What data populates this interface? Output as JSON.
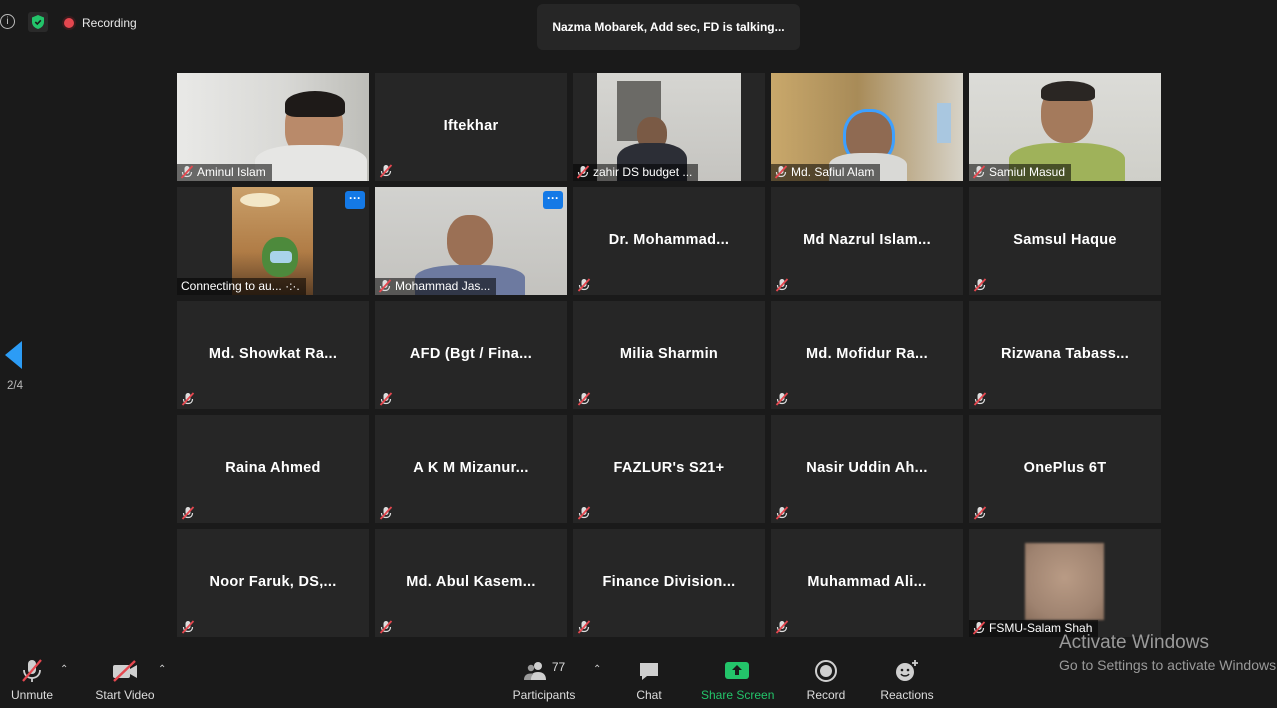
{
  "topbar": {
    "recording_label": "Recording",
    "speaking_banner": "Nazma Mobarek, Add sec, FD is talking...",
    "colors": {
      "recording": "#e5474f",
      "shield": "#23c46a"
    }
  },
  "pager": {
    "label": "2/4",
    "arrow_color": "#2c9cf5"
  },
  "tiles": [
    {
      "name": "Aminul Islam",
      "video": true,
      "muted": true
    },
    {
      "name": "Iftekhar",
      "video": false,
      "muted": true
    },
    {
      "name": "zahir DS budget ...",
      "video": true,
      "muted": true
    },
    {
      "name": "Md. Safiul Alam",
      "video": true,
      "muted": true
    },
    {
      "name": "Samiul Masud",
      "video": true,
      "muted": true
    },
    {
      "name": "Connecting to au... ·:·.",
      "video": true,
      "muted": false,
      "more": "···"
    },
    {
      "name": "Mohammad Jas...",
      "video": true,
      "muted": true,
      "more": "···"
    },
    {
      "name": "Dr.  Mohammad...",
      "video": false,
      "muted": true
    },
    {
      "name": "Md Nazrul Islam...",
      "video": false,
      "muted": true
    },
    {
      "name": "Samsul Haque",
      "video": false,
      "muted": true
    },
    {
      "name": "Md.  Showkat  Ra...",
      "video": false,
      "muted": true
    },
    {
      "name": "AFD (Bgt / Fina...",
      "video": false,
      "muted": true
    },
    {
      "name": "Milia Sharmin",
      "video": false,
      "muted": true
    },
    {
      "name": "Md.  Mofidur  Ra...",
      "video": false,
      "muted": true
    },
    {
      "name": "Rizwana  Tabass...",
      "video": false,
      "muted": true
    },
    {
      "name": "Raina Ahmed",
      "video": false,
      "muted": true
    },
    {
      "name": "A  K  M  Mizanur...",
      "video": false,
      "muted": true
    },
    {
      "name": "FAZLUR's S21+",
      "video": false,
      "muted": true
    },
    {
      "name": "Nasir  Uddin  Ah...",
      "video": false,
      "muted": true
    },
    {
      "name": "OnePlus 6T",
      "video": false,
      "muted": true
    },
    {
      "name": "Noor Faruk,  DS,...",
      "video": false,
      "muted": true
    },
    {
      "name": "Md.  Abul  Kasem...",
      "video": false,
      "muted": true
    },
    {
      "name": "Finance  Division...",
      "video": false,
      "muted": true
    },
    {
      "name": "Muhammad  Ali...",
      "video": false,
      "muted": true
    },
    {
      "name": "FSMU-Salam Shah",
      "video": true,
      "muted": true
    }
  ],
  "toolbar": {
    "unmute": "Unmute",
    "start_video": "Start Video",
    "participants": "Participants",
    "participants_count": "77",
    "chat": "Chat",
    "share_screen": "Share Screen",
    "record": "Record",
    "reactions": "Reactions",
    "colors": {
      "share": "#23c46a",
      "muted_red": "#e5474f"
    }
  },
  "watermark": {
    "line1": "Activate Windows",
    "line2": "Go to Settings to activate Windows."
  }
}
